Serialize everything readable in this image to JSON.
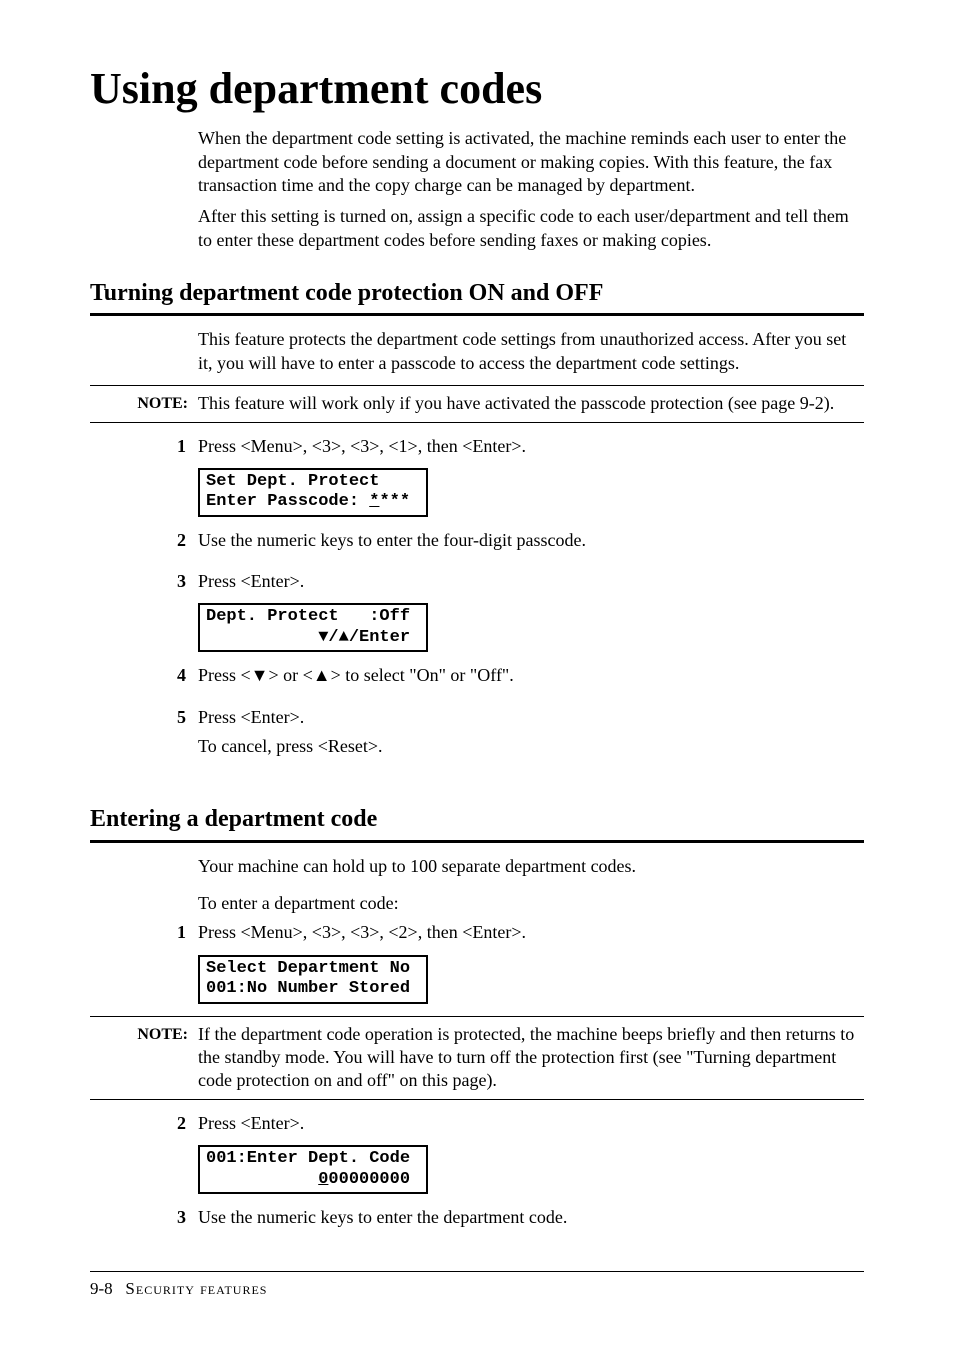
{
  "title": "Using department codes",
  "intro": {
    "p1": "When the department code setting is activated, the machine reminds each user to enter the department code before sending a document or making copies.  With this feature, the fax transaction time and the copy charge can be managed by department.",
    "p2": "After this setting is turned on, assign a specific code to each user/department and tell them to enter these department codes before sending faxes or making copies."
  },
  "secA": {
    "heading": "Turning department code protection ON and OFF",
    "intro": "This feature protects the department code settings from unauthorized access. After you set it, you will have to enter a passcode to access the department code settings.",
    "note_label": "NOTE:",
    "note_text": "This feature will work only if you have activated the passcode protection (see page 9-2).",
    "step1_num": "1",
    "step1_text": "Press <Menu>, <3>, <3>, <1>, then <Enter>.",
    "lcd1_line1": "Set Dept. Protect",
    "lcd1_line2a": "Enter Passcode: ",
    "lcd1_line2b": "*",
    "lcd1_line2c": "***",
    "step2_num": "2",
    "step2_text": "Use the numeric keys to enter the four-digit passcode.",
    "step3_num": "3",
    "step3_text": "Press <Enter>.",
    "lcd2_line1": "Dept. Protect   :Off",
    "lcd2_line2": "           ▼/▲/Enter",
    "step4_num": "4",
    "step4_text_a": "Press <",
    "step4_text_b": "> or <",
    "step4_text_c": "> to select \"On\" or \"Off\".",
    "down": "▼",
    "up": "▲",
    "step5_num": "5",
    "step5_text1": "Press <Enter>.",
    "step5_text2": "To cancel, press <Reset>."
  },
  "secB": {
    "heading": "Entering a department code",
    "intro1": "Your machine can hold up to 100 separate department codes.",
    "intro2": "To enter a department code:",
    "step1_num": "1",
    "step1_text": "Press <Menu>, <3>, <3>, <2>, then <Enter>.",
    "lcd1_line1": "Select Department No",
    "lcd1_line2": "001:No Number Stored",
    "note_label": "NOTE:",
    "note_text": "If the department code operation is protected, the machine beeps briefly and then returns to the standby mode.  You will have to turn off the protection first (see \"Turning department code protection on and off\" on this page).",
    "step2_num": "2",
    "step2_text": "Press <Enter>.",
    "lcd2_line1": "001:Enter Dept. Code",
    "lcd2_line2a": "           ",
    "lcd2_line2b": "0",
    "lcd2_line2c": "00000000",
    "step3_num": "3",
    "step3_text": "Use the numeric keys to enter the department code."
  },
  "footer": {
    "page": "9-8",
    "section": "Security features"
  }
}
